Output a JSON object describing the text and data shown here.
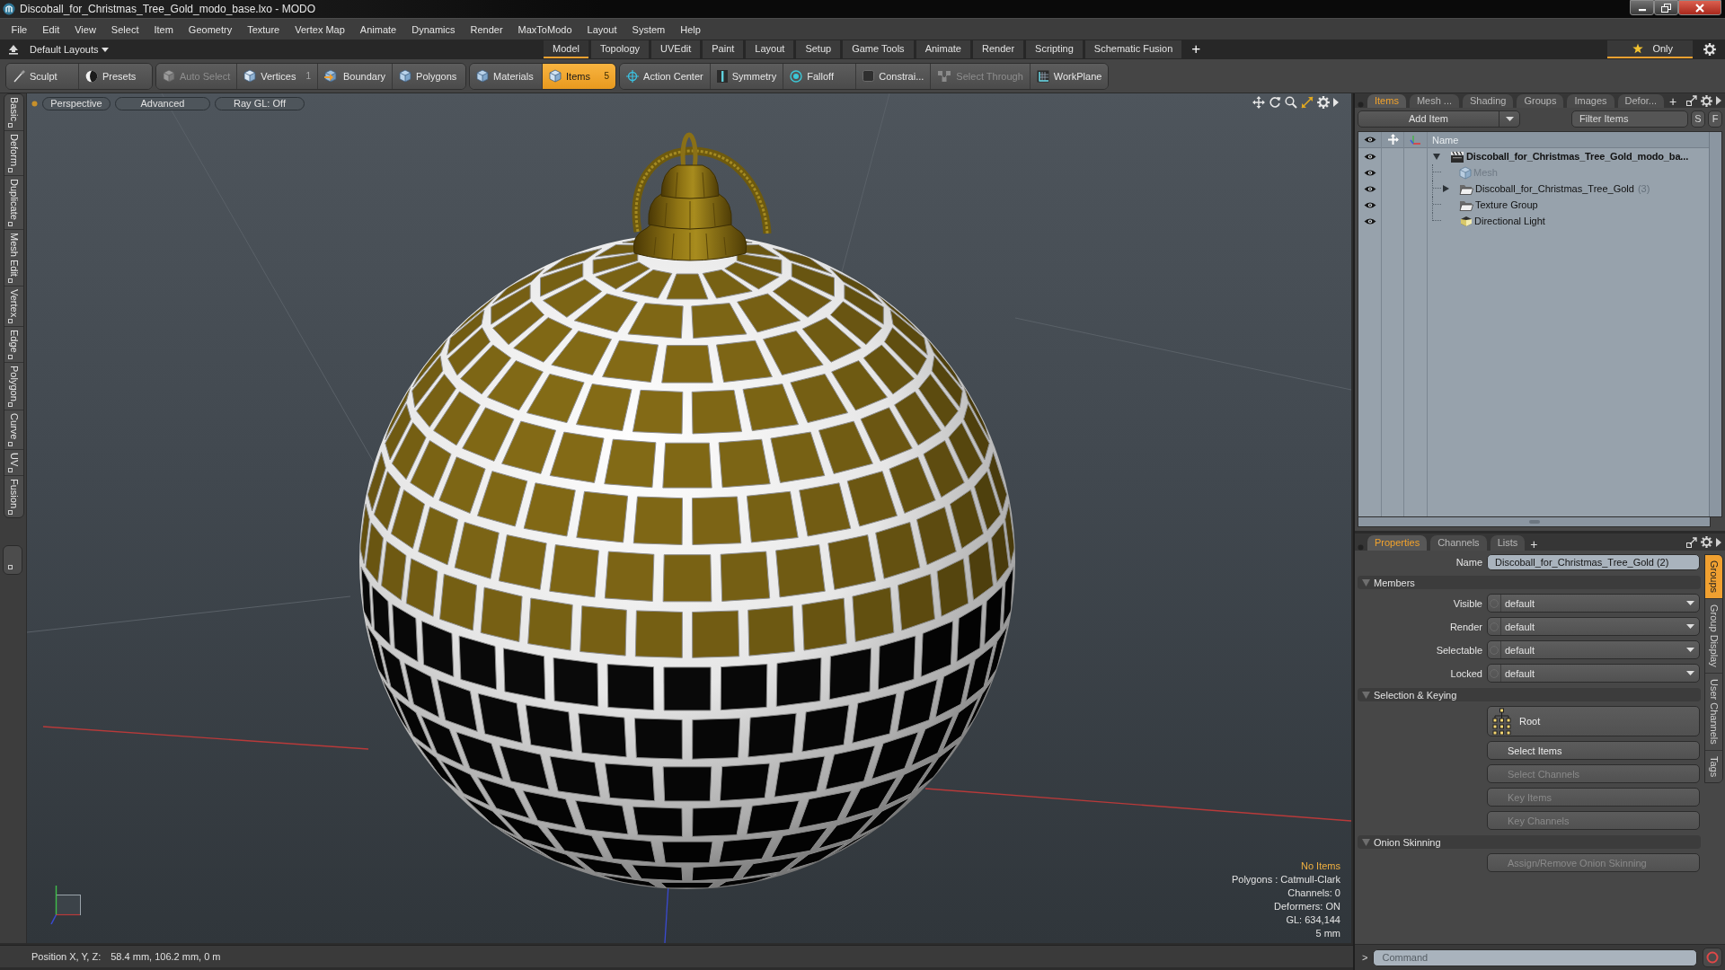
{
  "window": {
    "title": "Discoball_for_Christmas_Tree_Gold_modo_base.lxo - MODO"
  },
  "menu": [
    "File",
    "Edit",
    "View",
    "Select",
    "Item",
    "Geometry",
    "Texture",
    "Vertex Map",
    "Animate",
    "Dynamics",
    "Render",
    "MaxToModo",
    "Layout",
    "System",
    "Help"
  ],
  "layout_bar": {
    "layouts": "Default Layouts",
    "tabs": [
      {
        "label": "Model",
        "selected": true
      },
      {
        "label": "Topology",
        "selected": false
      },
      {
        "label": "UVEdit",
        "selected": false
      },
      {
        "label": "Paint",
        "selected": false
      },
      {
        "label": "Layout",
        "selected": false
      },
      {
        "label": "Setup",
        "selected": false
      },
      {
        "label": "Game Tools",
        "selected": false
      },
      {
        "label": "Animate",
        "selected": false
      },
      {
        "label": "Render",
        "selected": false
      },
      {
        "label": "Scripting",
        "selected": false
      },
      {
        "label": "Schematic Fusion",
        "selected": false
      }
    ],
    "add_tab": "+",
    "only": {
      "label": "Only",
      "on": true
    }
  },
  "toolbar": [
    {
      "items": [
        {
          "label": "Sculpt",
          "selected": false,
          "disabled": false
        },
        {
          "label": "Presets",
          "selected": false,
          "disabled": false
        }
      ]
    },
    {
      "items": [
        {
          "label": "Auto Select",
          "selected": false,
          "disabled": true
        },
        {
          "label": "Vertices",
          "count": "1",
          "selected": false,
          "disabled": false
        },
        {
          "label": "Boundary",
          "selected": false,
          "disabled": false
        },
        {
          "label": "Polygons",
          "selected": false,
          "disabled": false
        }
      ]
    },
    {
      "items": [
        {
          "label": "Materials",
          "selected": false,
          "disabled": false
        },
        {
          "label": "Items",
          "count": "5",
          "selected": true,
          "disabled": false
        }
      ]
    },
    {
      "items": [
        {
          "label": "Action Center",
          "selected": false,
          "disabled": false
        },
        {
          "label": "Symmetry",
          "selected": false,
          "disabled": false
        },
        {
          "label": "Falloff",
          "selected": false,
          "disabled": false
        },
        {
          "label": "Constrai...",
          "selected": false,
          "disabled": false
        },
        {
          "label": "Select Through",
          "selected": false,
          "disabled": true
        },
        {
          "label": "WorkPlane",
          "selected": false,
          "disabled": false
        }
      ]
    }
  ],
  "left_tabs": [
    "Basic",
    "Deform",
    "Duplicate",
    "Mesh Edit",
    "Vertex",
    "Edge",
    "Polygon",
    "Curve",
    "UV",
    "Fusion"
  ],
  "viewport": {
    "header": [
      "Perspective",
      "Advanced",
      "Ray GL: Off"
    ],
    "info_title": "No Items",
    "info_lines": [
      "Polygons : Catmull-Clark",
      "Channels: 0",
      "Deformers: ON",
      "GL: 634,144",
      "5 mm"
    ]
  },
  "status_bar": {
    "label": "Position X, Y, Z:",
    "value": "58.4 mm, 106.2 mm, 0 m"
  },
  "items_panel": {
    "tabs": [
      {
        "label": "Items",
        "selected": true
      },
      {
        "label": "Mesh ...",
        "selected": false
      },
      {
        "label": "Shading",
        "selected": false
      },
      {
        "label": "Groups",
        "selected": false
      },
      {
        "label": "Images",
        "selected": false
      },
      {
        "label": "Defor...",
        "selected": false
      }
    ],
    "add_tab": "+",
    "add_item": "Add Item",
    "filter": {
      "placeholder": "Filter Items"
    },
    "filter_buttons": [
      "S",
      "F"
    ],
    "name_column": "Name",
    "tree": [
      {
        "label": "Discoball_for_Christmas_Tree_Gold_modo_ba...",
        "kind": "scene",
        "expanded": true,
        "disabled": false,
        "visible": true,
        "children": [
          {
            "label": "Mesh",
            "kind": "mesh",
            "disabled": true,
            "visible": true
          },
          {
            "label": "Discoball_for_Christmas_Tree_Gold",
            "count": "(3)",
            "kind": "group",
            "expanded": false,
            "disabled": false,
            "visible": true
          },
          {
            "label": "Texture Group",
            "kind": "group",
            "disabled": false,
            "visible": true
          },
          {
            "label": "Directional Light",
            "kind": "light",
            "disabled": false,
            "visible": true
          }
        ]
      }
    ]
  },
  "properties_panel": {
    "tabs": [
      {
        "label": "Properties",
        "selected": true
      },
      {
        "label": "Channels",
        "selected": false
      },
      {
        "label": "Lists",
        "selected": false
      }
    ],
    "add_tab": "+",
    "name": {
      "label": "Name",
      "value": "Discoball_for_Christmas_Tree_Gold (2)"
    },
    "sections": [
      {
        "title": "Members",
        "expanded": true,
        "rows": [
          {
            "kind": "dropdown",
            "label": "Visible",
            "value": "default",
            "disabled": false
          },
          {
            "kind": "dropdown",
            "label": "Render",
            "value": "default",
            "disabled": false
          },
          {
            "kind": "dropdown",
            "label": "Selectable",
            "value": "default",
            "disabled": false
          },
          {
            "kind": "dropdown",
            "label": "Locked",
            "value": "default",
            "disabled": false
          }
        ]
      },
      {
        "title": "Selection & Keying",
        "expanded": true,
        "rows": [
          {
            "kind": "hierarchy",
            "label": "Root",
            "disabled": false
          },
          {
            "kind": "button",
            "label": "Select Items",
            "disabled": false
          },
          {
            "kind": "button",
            "label": "Select Channels",
            "disabled": true
          },
          {
            "kind": "button",
            "label": "Key Items",
            "disabled": true
          },
          {
            "kind": "button",
            "label": "Key Channels",
            "disabled": true
          }
        ]
      },
      {
        "title": "Onion Skinning",
        "expanded": true,
        "rows": [
          {
            "kind": "button",
            "label": "Assign/Remove Onion Skinning",
            "disabled": true
          }
        ]
      }
    ],
    "side_tabs": [
      {
        "label": "Groups",
        "selected": true
      },
      {
        "label": "Group Display",
        "selected": false
      },
      {
        "label": "User Channels",
        "selected": false
      },
      {
        "label": "Tags",
        "selected": false
      }
    ]
  },
  "command_line": {
    "prompt": ">",
    "placeholder": "Command"
  }
}
